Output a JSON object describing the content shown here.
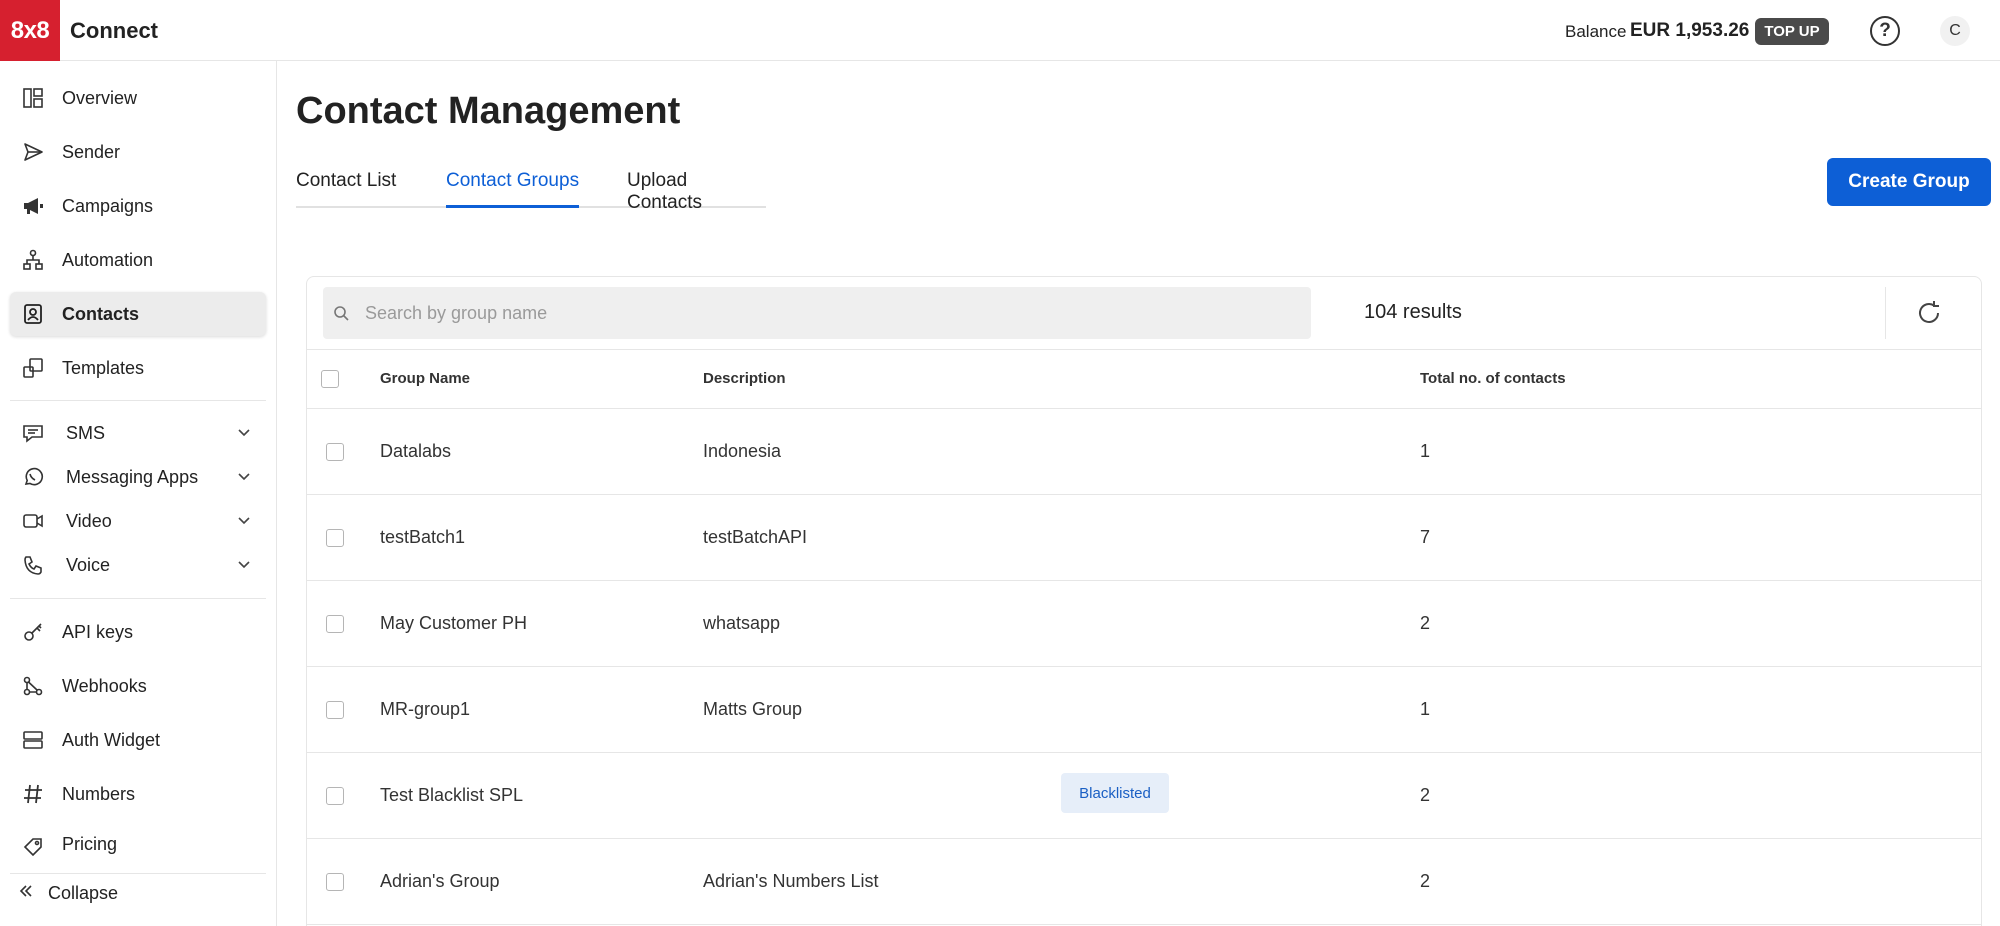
{
  "header": {
    "logo_text": "8x8",
    "brand": "Connect",
    "balance_label": "Balance",
    "balance_value": "EUR 1,953.26",
    "topup_label": "TOP UP",
    "help_symbol": "?",
    "avatar_initial": "C"
  },
  "sidebar": {
    "items": [
      {
        "label": "Overview",
        "icon": "dashboard-icon"
      },
      {
        "label": "Sender",
        "icon": "send-icon"
      },
      {
        "label": "Campaigns",
        "icon": "megaphone-icon"
      },
      {
        "label": "Automation",
        "icon": "flow-icon"
      },
      {
        "label": "Contacts",
        "icon": "contacts-icon",
        "active": true
      },
      {
        "label": "Templates",
        "icon": "templates-icon"
      },
      {
        "label": "SMS",
        "icon": "chat-icon",
        "expandable": true
      },
      {
        "label": "Messaging Apps",
        "icon": "whatsapp-icon",
        "expandable": true
      },
      {
        "label": "Video",
        "icon": "video-icon",
        "expandable": true
      },
      {
        "label": "Voice",
        "icon": "phone-icon",
        "expandable": true
      },
      {
        "label": "API keys",
        "icon": "key-icon"
      },
      {
        "label": "Webhooks",
        "icon": "webhook-icon"
      },
      {
        "label": "Auth Widget",
        "icon": "server-icon"
      },
      {
        "label": "Numbers",
        "icon": "hash-icon"
      },
      {
        "label": "Pricing",
        "icon": "tag-icon"
      }
    ],
    "collapse_label": "Collapse"
  },
  "main": {
    "title": "Contact Management",
    "tabs": [
      {
        "label": "Contact List"
      },
      {
        "label": "Contact Groups",
        "active": true
      },
      {
        "label": "Upload Contacts"
      }
    ],
    "create_button": "Create Group",
    "search": {
      "placeholder": "Search by group name",
      "value": ""
    },
    "results_text": "104 results",
    "table": {
      "columns": [
        "Group Name",
        "Description",
        "Total no. of contacts"
      ],
      "rows": [
        {
          "name": "Datalabs",
          "description": "Indonesia",
          "badge": "",
          "total": "1"
        },
        {
          "name": "testBatch1",
          "description": "testBatchAPI",
          "badge": "",
          "total": "7"
        },
        {
          "name": "May Customer PH",
          "description": "whatsapp",
          "badge": "",
          "total": "2"
        },
        {
          "name": "MR-group1",
          "description": "Matts Group",
          "badge": "",
          "total": "1"
        },
        {
          "name": "Test Blacklist SPL",
          "description": "",
          "badge": "Blacklisted",
          "total": "2"
        },
        {
          "name": "Adrian's Group",
          "description": "Adrian's Numbers List",
          "badge": "",
          "total": "2"
        }
      ]
    }
  },
  "colors": {
    "brand_red": "#d6202f",
    "accent_blue": "#0d5fd6",
    "badge_bg": "#e6eef9"
  }
}
